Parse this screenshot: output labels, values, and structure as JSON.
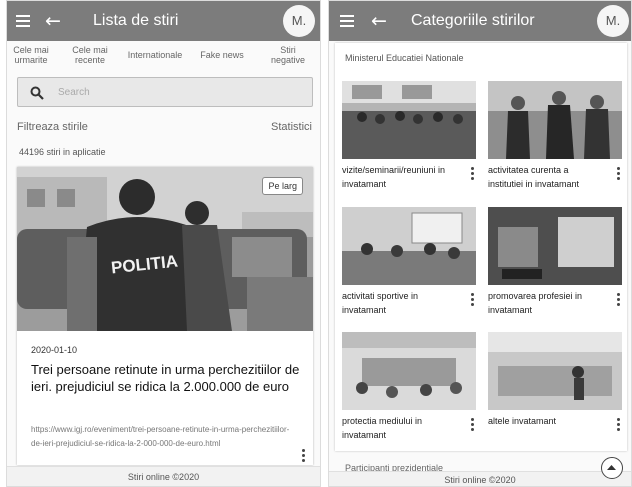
{
  "left": {
    "appbar": {
      "title": "Lista de stiri",
      "avatar": "M."
    },
    "tabs": [
      "Cele mai\nurmarite",
      "Cele mai\nrecente",
      "Internationale",
      "Fake news",
      "Stiri\nnegative"
    ],
    "search": {
      "placeholder": "Search"
    },
    "filter_label": "Filtreaza stirile",
    "stats_label": "Statistici",
    "count_text": "44196 stiri in aplicatie",
    "article": {
      "badge": "Pe larg",
      "image_text": "POLITIA",
      "date": "2020-01-10",
      "headline": "Trei persoane retinute in urma perchezitiilor de ieri. prejudiciul se ridica la 2.000.000 de euro",
      "url": "https://www.igj.ro/eveniment/trei-persoane-retinute-in-urma-perchezitiilor-de-ieri-prejudiciul-se-ridica-la-2-000-000-de-euro.html"
    },
    "footer": "Stiri online ©2020"
  },
  "right": {
    "appbar": {
      "title": "Categoriile stirilor",
      "avatar": "M."
    },
    "section_title": "Ministerul Educatiei Nationale",
    "categories": [
      {
        "label": "vizite/seminarii/reuniuni in invatamant"
      },
      {
        "label": "activitatea curenta a institutiei in invatamant"
      },
      {
        "label": "activitati sportive in invatamant"
      },
      {
        "label": "promovarea profesiei in invatamant"
      },
      {
        "label": "protectia mediului in invatamant"
      },
      {
        "label": "altele invatamant"
      }
    ],
    "next_section": "Participanti prezidentiale",
    "footer": "Stiri online ©2020"
  }
}
